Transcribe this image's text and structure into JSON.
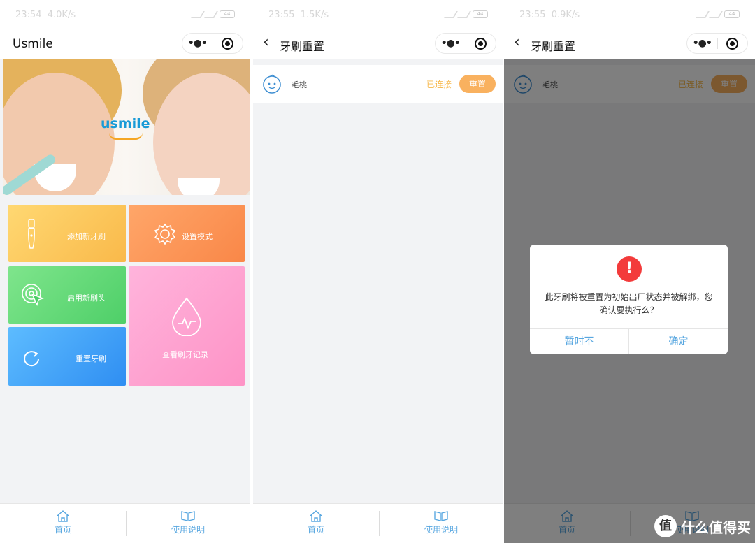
{
  "screens": [
    {
      "status": {
        "time": "23:54",
        "speed": "4.0K/s",
        "battery": "44"
      },
      "title": "Usmile",
      "banner": {
        "logo": "usmile"
      },
      "tiles": {
        "add": "添加新牙刷",
        "mode": "设置模式",
        "head": "启用新刷头",
        "reset": "重置牙刷",
        "record": "查看刷牙记录"
      }
    },
    {
      "status": {
        "time": "23:55",
        "speed": "1.5K/s",
        "battery": "44"
      },
      "title": "牙刷重置",
      "device": {
        "name": "毛桃",
        "status": "已连接",
        "reset_label": "重置"
      }
    },
    {
      "status": {
        "time": "23:55",
        "speed": "0.9K/s",
        "battery": "44"
      },
      "title": "牙刷重置",
      "device": {
        "name": "毛桃",
        "status": "已连接",
        "reset_label": "重置"
      },
      "dialog": {
        "icon": "!",
        "message": "此牙刷将被重置为初始出厂状态并被解绑，您确认要执行么？",
        "cancel": "暂时不",
        "confirm": "确定"
      },
      "watermark": {
        "badge": "值",
        "text": "什么值得买"
      }
    }
  ],
  "tabbar": {
    "home": "首页",
    "manual": "使用说明"
  },
  "icons": {
    "capsule_more": "more-icon",
    "capsule_close": "close-target-icon",
    "home": "home-icon",
    "manual": "book-icon"
  },
  "colors": {
    "accent": "#58a7e0",
    "reset": "#f9b15f",
    "alert": "#f33b3b"
  }
}
